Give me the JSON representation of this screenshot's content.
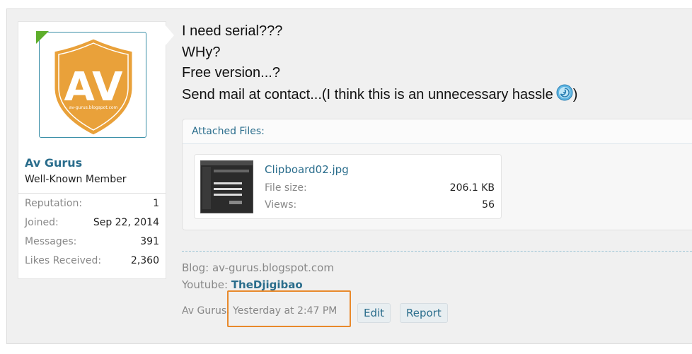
{
  "user": {
    "avatar_text": "AV",
    "avatar_subtext": "av-gurus.blogspot.com",
    "name": "Av Gurus",
    "title": "Well-Known Member",
    "stats": [
      {
        "label": "Reputation:",
        "value": "1"
      },
      {
        "label": "Joined:",
        "value": "Sep 22, 2014"
      },
      {
        "label": "Messages:",
        "value": "391"
      },
      {
        "label": "Likes Received:",
        "value": "2,360"
      }
    ]
  },
  "message": {
    "lines": [
      "I need serial???",
      "WHy?",
      "Free version...?",
      "Send mail at contact...(I think this is an unnecessary hassle"
    ],
    "line4_suffix": ")"
  },
  "attachments": {
    "title": "Attached Files:",
    "file": {
      "name": "Clipboard02.jpg",
      "size_label": "File size:",
      "size_value": "206.1 KB",
      "views_label": "Views:",
      "views_value": "56"
    }
  },
  "signature": {
    "blog": "Blog: av-gurus.blogspot.com",
    "youtube_label": "Youtube: ",
    "youtube_link": "TheDjigibao"
  },
  "meta": {
    "author": "Av Gurus",
    "separator": ", ",
    "date": "Yesterday at 2:47 PM",
    "edit_label": "Edit",
    "report_label": "Report"
  },
  "colors": {
    "link": "#2a6d8c",
    "shield": "#e9a13a",
    "highlight": "#e8892b"
  }
}
